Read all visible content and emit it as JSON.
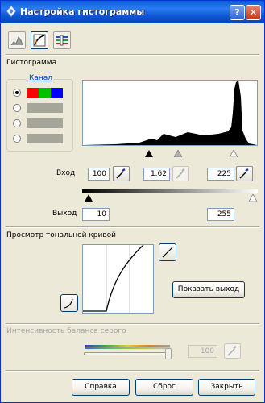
{
  "window": {
    "title": "Настройка гистограммы",
    "help_label": "?",
    "close_label": "✕"
  },
  "toolbar": {
    "icons": [
      "histogram-icon",
      "tone-curve-icon",
      "color-balance-icon"
    ]
  },
  "histogram": {
    "section_label": "Гистограмма",
    "channel_group_label": "Канал",
    "channels": [
      {
        "selected": true,
        "colors": [
          "#ff0000",
          "#00c000",
          "#0000ff"
        ]
      },
      {
        "selected": false,
        "colors": [
          "#a6a59a"
        ]
      },
      {
        "selected": false,
        "colors": [
          "#a6a59a"
        ]
      },
      {
        "selected": false,
        "colors": [
          "#a6a59a"
        ]
      }
    ]
  },
  "input": {
    "label": "Вход",
    "shadow": "100",
    "gamma": "1.62",
    "highlight": "225"
  },
  "output": {
    "label": "Выход",
    "min": "10",
    "max": "255"
  },
  "tone_curve": {
    "label": "Просмотр тональной кривой"
  },
  "show_output_button": "Показать выход",
  "gray_balance": {
    "label": "Интенсивность баланса серого",
    "value": "100"
  },
  "buttons": {
    "help": "Справка",
    "reset": "Сброс",
    "close": "Закрыть"
  }
}
